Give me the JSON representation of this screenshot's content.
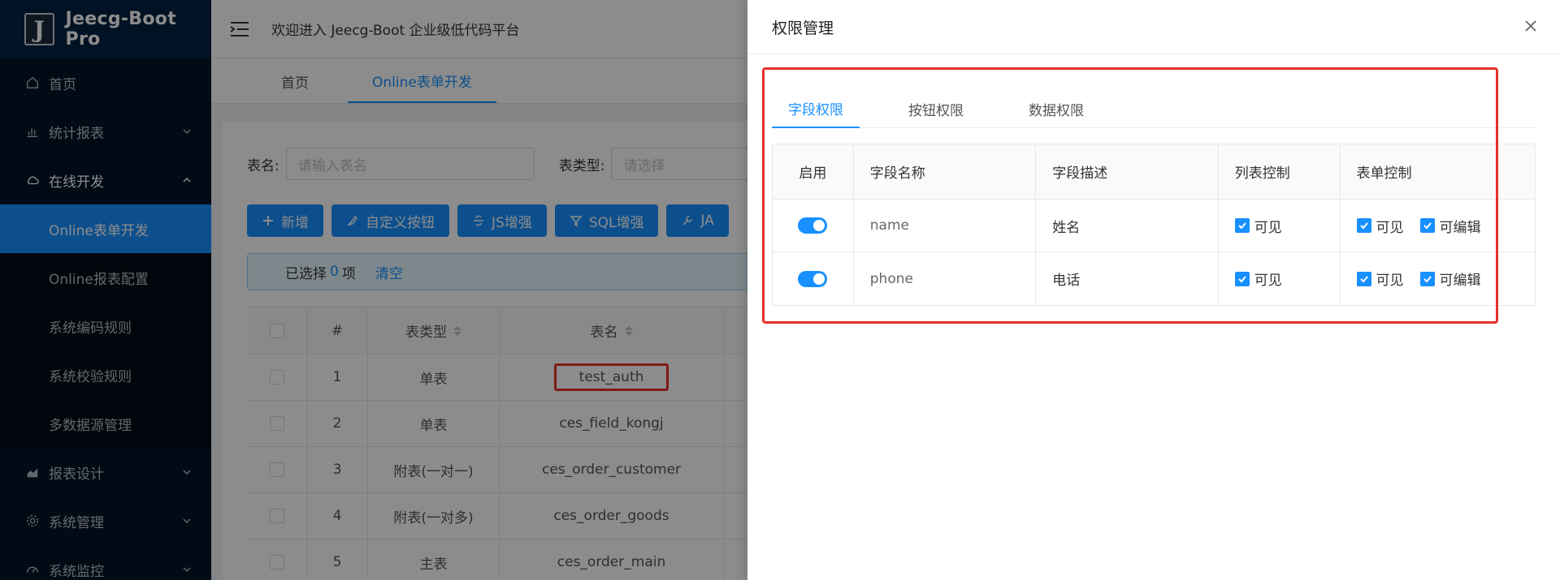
{
  "sidebar": {
    "logo_letter": "J",
    "logo_text": "Jeecg-Boot Pro",
    "items": [
      {
        "label": "首页",
        "icon": "home-icon"
      },
      {
        "label": "统计报表",
        "icon": "chart-bars-icon"
      },
      {
        "label": "在线开发",
        "icon": "cloud-icon"
      },
      {
        "label": "报表设计",
        "icon": "area-chart-icon"
      },
      {
        "label": "系统管理",
        "icon": "gear-icon"
      },
      {
        "label": "系统监控",
        "icon": "dashboard-icon"
      }
    ],
    "submenu": [
      {
        "label": "Online表单开发"
      },
      {
        "label": "Online报表配置"
      },
      {
        "label": "系统编码规则"
      },
      {
        "label": "系统校验规则"
      },
      {
        "label": "多数据源管理"
      }
    ]
  },
  "header": {
    "title": "欢迎进入 Jeecg-Boot 企业级低代码平台"
  },
  "tabs": [
    {
      "label": "首页"
    },
    {
      "label": "Online表单开发"
    }
  ],
  "search": {
    "name_label": "表名:",
    "name_placeholder": "请输入表名",
    "type_label": "表类型:",
    "type_placeholder": "请选择"
  },
  "toolbar": {
    "add": "新增",
    "custom_button": "自定义按钮",
    "js_enhance": "JS增强",
    "sql_enhance": "SQL增强",
    "java_partial": "JA"
  },
  "alert": {
    "prefix": "已选择",
    "count": "0",
    "suffix": "项",
    "clear": "清空"
  },
  "table": {
    "headers": {
      "index": "#",
      "type": "表类型",
      "name": "表名"
    },
    "rows": [
      {
        "index": "1",
        "type": "单表",
        "name": "test_auth"
      },
      {
        "index": "2",
        "type": "单表",
        "name": "ces_field_kongj"
      },
      {
        "index": "3",
        "type": "附表(一对一)",
        "name": "ces_order_customer"
      },
      {
        "index": "4",
        "type": "附表(一对多)",
        "name": "ces_order_goods"
      },
      {
        "index": "5",
        "type": "主表",
        "name": "ces_order_main"
      }
    ]
  },
  "drawer": {
    "title": "权限管理",
    "tabs": [
      {
        "label": "字段权限"
      },
      {
        "label": "按钮权限"
      },
      {
        "label": "数据权限"
      }
    ],
    "headers": {
      "enable": "启用",
      "field_name": "字段名称",
      "field_desc": "字段描述",
      "list_ctrl": "列表控制",
      "form_ctrl": "表单控制"
    },
    "rows": [
      {
        "field_name": "name",
        "field_desc": "姓名",
        "list_visible": "可见",
        "form_visible": "可见",
        "form_editable": "可编辑"
      },
      {
        "field_name": "phone",
        "field_desc": "电话",
        "list_visible": "可见",
        "form_visible": "可见",
        "form_editable": "可编辑"
      }
    ]
  },
  "colors": {
    "primary": "#1890ff",
    "sidebar_bg": "#001529",
    "highlight": "#e8312a"
  }
}
